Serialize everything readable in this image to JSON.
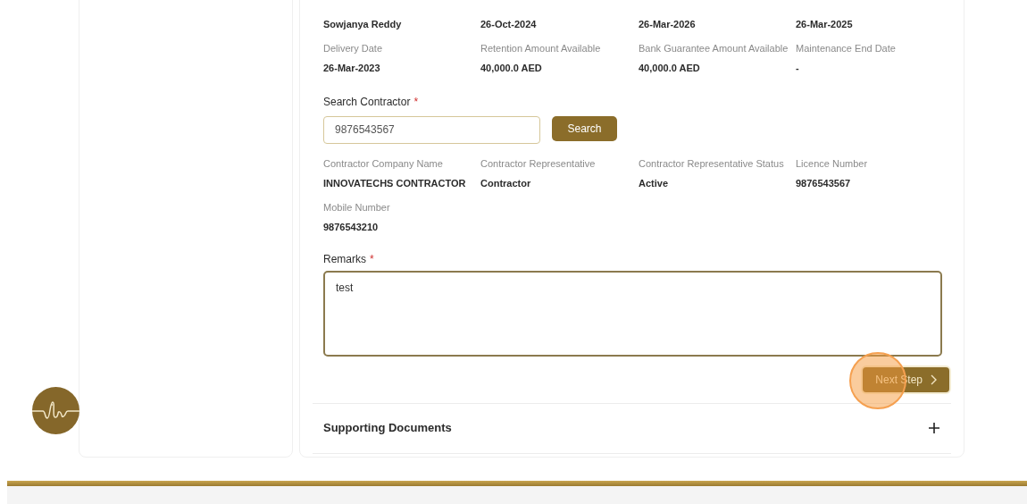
{
  "top_values": [
    "Sowjanya Reddy",
    "26-Oct-2024",
    "26-Mar-2026",
    "26-Mar-2025"
  ],
  "details": [
    {
      "label": "Delivery Date",
      "value": "26-Mar-2023"
    },
    {
      "label": "Retention Amount Available",
      "value": "40,000.0 AED"
    },
    {
      "label": "Bank Guarantee Amount Available",
      "value": "40,000.0 AED"
    },
    {
      "label": "Maintenance End Date",
      "value": "-"
    }
  ],
  "search_contractor": {
    "label": "Search Contractor",
    "required_mark": "*",
    "value": "9876543567",
    "button": "Search"
  },
  "contractor": [
    {
      "label": "Contractor Company Name",
      "value": "INNOVATECHS CONTRACTOR"
    },
    {
      "label": "Contractor Representative",
      "value": "Contractor"
    },
    {
      "label": "Contractor Representative Status",
      "value": "Active"
    },
    {
      "label": "Licence Number",
      "value": "9876543567"
    },
    {
      "label": "Mobile Number",
      "value": "9876543210"
    }
  ],
  "remarks": {
    "label": "Remarks",
    "required_mark": "*",
    "value": "test"
  },
  "next_button": "Next Step",
  "sections": [
    {
      "title": "Supporting Documents",
      "expanded": false
    }
  ]
}
